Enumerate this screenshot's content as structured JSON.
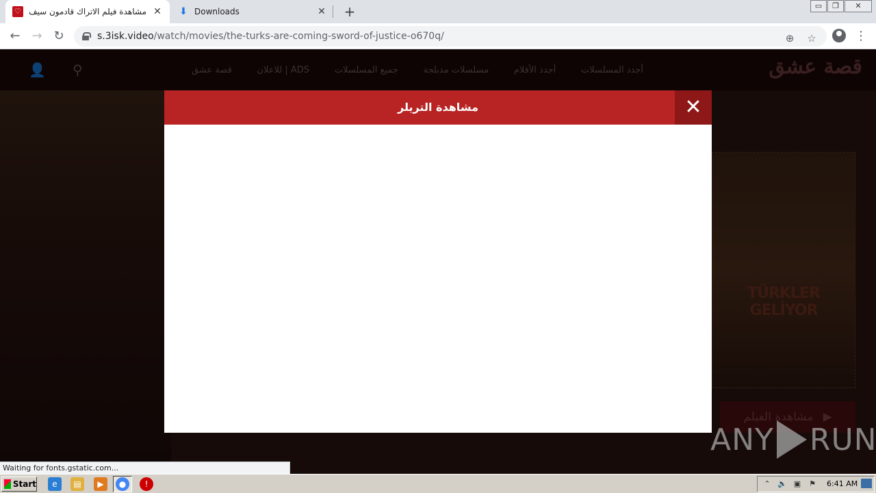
{
  "browser": {
    "tabs": [
      {
        "title": "مشاهدة فيلم الاتراك قادمون سيف الع",
        "active": true
      },
      {
        "title": "Downloads",
        "active": false
      }
    ],
    "new_tab_label": "+",
    "window_controls": {
      "minimize": "▭",
      "restore": "❐",
      "close": "✕"
    },
    "url_host": "s.3isk.video",
    "url_path": "/watch/movies/the-turks-are-coming-sword-of-justice-o670q/"
  },
  "site": {
    "logo": "قصة عشق",
    "nav": [
      "أجدد المسلسلات",
      "أجدد الأفلام",
      "مسلسلات مدبلجة",
      "جميع المسلسلات",
      "للاعلان | ADS",
      "قصة عشق"
    ],
    "poster_text": "TÜRKLER GELİYOR",
    "watch_button": "مشاهدة الفيلم"
  },
  "modal": {
    "title": "مشاهدة التريلر",
    "close_label": "✕"
  },
  "watermark": {
    "left": "ANY",
    "right": "RUN"
  },
  "status": "Waiting for fonts.gstatic.com...",
  "taskbar": {
    "start_label": "Start",
    "clock": "6:41 AM"
  },
  "colors": {
    "modal_header": "#b82424",
    "modal_close_bg": "#8e1818"
  }
}
